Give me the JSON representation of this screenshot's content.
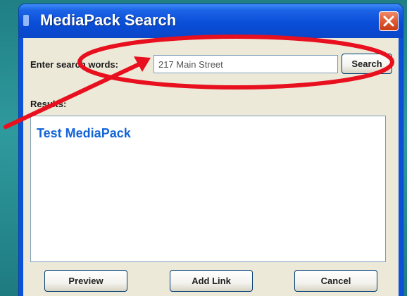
{
  "window": {
    "title": "MediaPack Search"
  },
  "search": {
    "label": "Enter search words:",
    "value": "217 Main Street",
    "button_label": "Search"
  },
  "results": {
    "label": "Results:",
    "items": [
      "Test MediaPack"
    ]
  },
  "footer": {
    "preview_label": "Preview",
    "add_link_label": "Add Link",
    "cancel_label": "Cancel"
  },
  "colors": {
    "titlebar": "#0a4ed8",
    "close_button": "#e05a32",
    "result_link": "#1464d8",
    "annotation": "#e8101e"
  },
  "icons": {
    "window": "app-icon",
    "close": "close-icon"
  }
}
